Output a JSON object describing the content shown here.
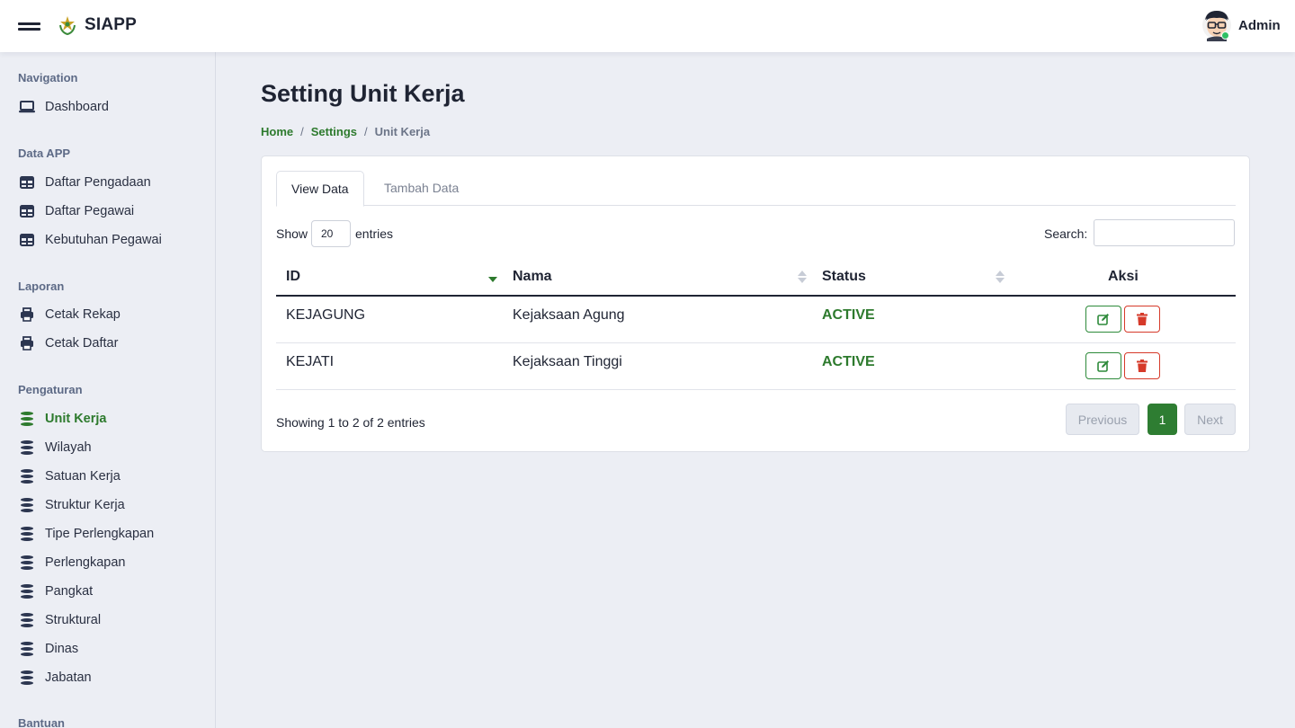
{
  "app": {
    "brand": "SIAPP",
    "user": "Admin"
  },
  "sidebar": {
    "sections": [
      {
        "title": "Navigation",
        "items": [
          {
            "label": "Dashboard",
            "icon": "laptop-icon"
          }
        ]
      },
      {
        "title": "Data APP",
        "items": [
          {
            "label": "Daftar Pengadaan",
            "icon": "table-icon"
          },
          {
            "label": "Daftar Pegawai",
            "icon": "table-icon"
          },
          {
            "label": "Kebutuhan Pegawai",
            "icon": "table-icon"
          }
        ]
      },
      {
        "title": "Laporan",
        "items": [
          {
            "label": "Cetak Rekap",
            "icon": "printer-icon"
          },
          {
            "label": "Cetak Daftar",
            "icon": "printer-icon"
          }
        ]
      },
      {
        "title": "Pengaturan",
        "items": [
          {
            "label": "Unit Kerja",
            "icon": "database-icon",
            "active": true
          },
          {
            "label": "Wilayah",
            "icon": "database-icon"
          },
          {
            "label": "Satuan Kerja",
            "icon": "database-icon"
          },
          {
            "label": "Struktur Kerja",
            "icon": "database-icon"
          },
          {
            "label": "Tipe Perlengkapan",
            "icon": "database-icon"
          },
          {
            "label": "Perlengkapan",
            "icon": "database-icon"
          },
          {
            "label": "Pangkat",
            "icon": "database-icon"
          },
          {
            "label": "Struktural",
            "icon": "database-icon"
          },
          {
            "label": "Dinas",
            "icon": "database-icon"
          },
          {
            "label": "Jabatan",
            "icon": "database-icon"
          }
        ]
      },
      {
        "title": "Bantuan",
        "items": []
      }
    ]
  },
  "page": {
    "title": "Setting Unit Kerja",
    "breadcrumb": {
      "home": "Home",
      "settings": "Settings",
      "current": "Unit Kerja",
      "separator": "/"
    }
  },
  "tabs": {
    "view": "View Data",
    "add": "Tambah Data"
  },
  "table_controls": {
    "show_label": "Show",
    "page_size": "20",
    "entries_label": "entries",
    "search_label": "Search:",
    "search_value": ""
  },
  "table": {
    "columns": [
      "ID",
      "Nama",
      "Status",
      "Aksi"
    ],
    "rows": [
      {
        "id": "KEJAGUNG",
        "nama": "Kejaksaan Agung",
        "status": "ACTIVE"
      },
      {
        "id": "KEJATI",
        "nama": "Kejaksaan Tinggi",
        "status": "ACTIVE"
      }
    ]
  },
  "footer": {
    "info": "Showing 1 to 2 of 2 entries",
    "previous": "Previous",
    "page": "1",
    "next": "Next"
  },
  "colors": {
    "accent_green": "#2e7d32",
    "danger_red": "#d63a2a",
    "online": "#2fbf63"
  }
}
